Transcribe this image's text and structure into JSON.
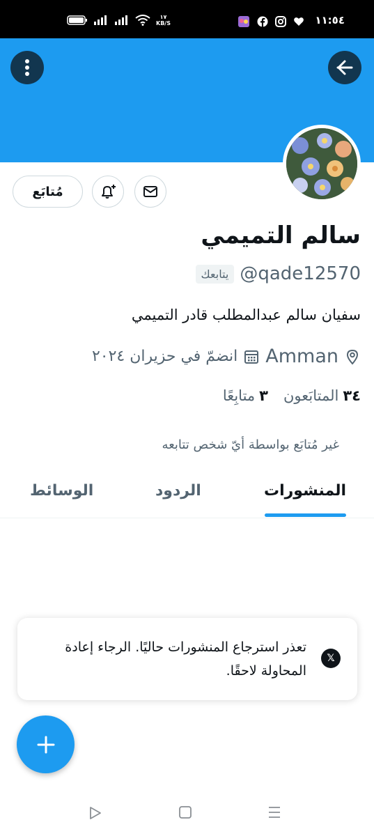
{
  "status_bar": {
    "time": "١١:٥٤",
    "net_speed_value": "١٧",
    "net_speed_unit": "KB/S",
    "icons": [
      "battery-icon",
      "signal-icon",
      "signal-icon",
      "wifi-icon",
      "app-notification-icon",
      "facebook-icon",
      "instagram-icon",
      "heart-icon"
    ]
  },
  "header": {
    "back_icon": "arrow-right-icon",
    "more_icon": "more-vertical-icon",
    "banner_color": "#1d9bf0"
  },
  "profile": {
    "display_name": "سالم التميمي",
    "handle": "@qade12570",
    "follows_you": "يتابعك",
    "bio": "سفيان سالم عبدالمطلب قادر التميمي",
    "location": "Amman",
    "joined": "انضمّ في حزيران ٢٠٢٤",
    "following_count": "٣",
    "following_label": "متابِعًا",
    "followers_count": "٣٤",
    "followers_label": "المتابَعون",
    "not_followed_note": "غير مُتابَع بواسطة أيّ شخص تتابعه"
  },
  "actions": {
    "follow_label": "مُتابَع"
  },
  "tabs": [
    {
      "label": "المنشورات",
      "active": true
    },
    {
      "label": "الردود",
      "active": false
    },
    {
      "label": "الوسائط",
      "active": false
    }
  ],
  "toast": {
    "message": "تعذر استرجاع المنشورات حاليًا. الرجاء إعادة المحاولة لاحقًا.",
    "icon": "x-logo-icon"
  },
  "fab": {
    "icon": "plus-icon"
  },
  "colors": {
    "accent": "#1d9bf0",
    "text": "#0f1419",
    "secondary": "#536471"
  }
}
